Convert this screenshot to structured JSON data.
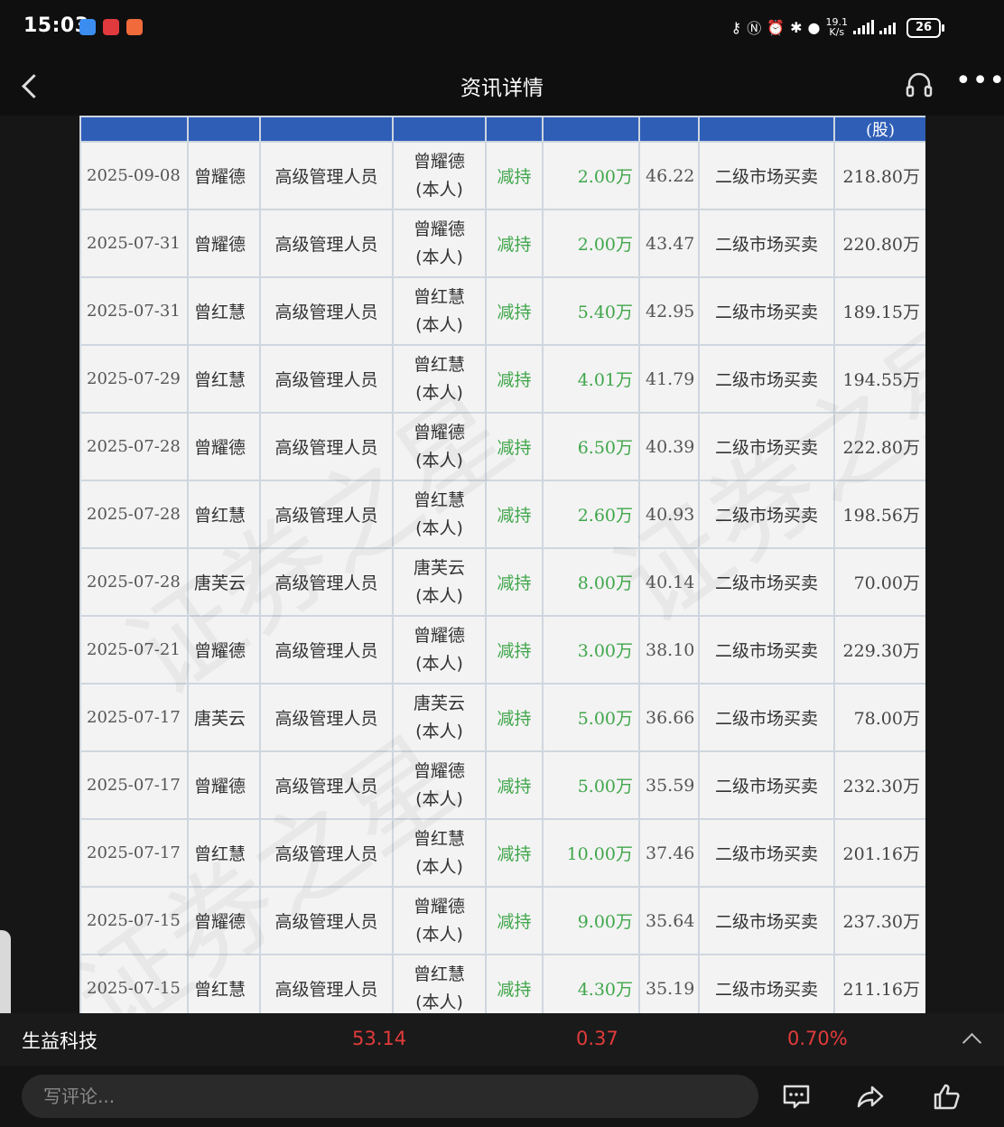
{
  "status_bar": {
    "time": "15:03",
    "speed_value": "19.1",
    "speed_unit": "K/s",
    "battery": "26"
  },
  "header": {
    "title": "资讯详情"
  },
  "table": {
    "header_visible_text": [
      "",
      "",
      "",
      "",
      "",
      "",
      "",
      "",
      "(股)"
    ],
    "rows": [
      {
        "date": "2025-09-08",
        "name": "曾耀德",
        "role": "高级管理人员",
        "rel_name": "曾耀德",
        "rel_note": "(本人)",
        "direction": "减持",
        "change": "2.00万",
        "price": "46.22",
        "method": "二级市场买卖",
        "holding": "218.80万"
      },
      {
        "date": "2025-07-31",
        "name": "曾耀德",
        "role": "高级管理人员",
        "rel_name": "曾耀德",
        "rel_note": "(本人)",
        "direction": "减持",
        "change": "2.00万",
        "price": "43.47",
        "method": "二级市场买卖",
        "holding": "220.80万"
      },
      {
        "date": "2025-07-31",
        "name": "曾红慧",
        "role": "高级管理人员",
        "rel_name": "曾红慧",
        "rel_note": "(本人)",
        "direction": "减持",
        "change": "5.40万",
        "price": "42.95",
        "method": "二级市场买卖",
        "holding": "189.15万"
      },
      {
        "date": "2025-07-29",
        "name": "曾红慧",
        "role": "高级管理人员",
        "rel_name": "曾红慧",
        "rel_note": "(本人)",
        "direction": "减持",
        "change": "4.01万",
        "price": "41.79",
        "method": "二级市场买卖",
        "holding": "194.55万"
      },
      {
        "date": "2025-07-28",
        "name": "曾耀德",
        "role": "高级管理人员",
        "rel_name": "曾耀德",
        "rel_note": "(本人)",
        "direction": "减持",
        "change": "6.50万",
        "price": "40.39",
        "method": "二级市场买卖",
        "holding": "222.80万"
      },
      {
        "date": "2025-07-28",
        "name": "曾红慧",
        "role": "高级管理人员",
        "rel_name": "曾红慧",
        "rel_note": "(本人)",
        "direction": "减持",
        "change": "2.60万",
        "price": "40.93",
        "method": "二级市场买卖",
        "holding": "198.56万"
      },
      {
        "date": "2025-07-28",
        "name": "唐芙云",
        "role": "高级管理人员",
        "rel_name": "唐芙云",
        "rel_note": "(本人)",
        "direction": "减持",
        "change": "8.00万",
        "price": "40.14",
        "method": "二级市场买卖",
        "holding": "70.00万"
      },
      {
        "date": "2025-07-21",
        "name": "曾耀德",
        "role": "高级管理人员",
        "rel_name": "曾耀德",
        "rel_note": "(本人)",
        "direction": "减持",
        "change": "3.00万",
        "price": "38.10",
        "method": "二级市场买卖",
        "holding": "229.30万"
      },
      {
        "date": "2025-07-17",
        "name": "唐芙云",
        "role": "高级管理人员",
        "rel_name": "唐芙云",
        "rel_note": "(本人)",
        "direction": "减持",
        "change": "5.00万",
        "price": "36.66",
        "method": "二级市场买卖",
        "holding": "78.00万"
      },
      {
        "date": "2025-07-17",
        "name": "曾耀德",
        "role": "高级管理人员",
        "rel_name": "曾耀德",
        "rel_note": "(本人)",
        "direction": "减持",
        "change": "5.00万",
        "price": "35.59",
        "method": "二级市场买卖",
        "holding": "232.30万"
      },
      {
        "date": "2025-07-17",
        "name": "曾红慧",
        "role": "高级管理人员",
        "rel_name": "曾红慧",
        "rel_note": "(本人)",
        "direction": "减持",
        "change": "10.00万",
        "price": "37.46",
        "method": "二级市场买卖",
        "holding": "201.16万"
      },
      {
        "date": "2025-07-15",
        "name": "曾耀德",
        "role": "高级管理人员",
        "rel_name": "曾耀德",
        "rel_note": "(本人)",
        "direction": "减持",
        "change": "9.00万",
        "price": "35.64",
        "method": "二级市场买卖",
        "holding": "237.30万"
      },
      {
        "date": "2025-07-15",
        "name": "曾红慧",
        "role": "高级管理人员",
        "rel_name": "曾红慧",
        "rel_note": "(本人)",
        "direction": "减持",
        "change": "4.30万",
        "price": "35.19",
        "method": "二级市场买卖",
        "holding": "211.16万"
      }
    ]
  },
  "watermark": "证券之星",
  "quote": {
    "stock_name": "生益科技",
    "price": "53.14",
    "change": "0.37",
    "change_pct": "0.70%"
  },
  "bottom": {
    "comment_placeholder": "写评论..."
  },
  "colors": {
    "header_blue": "#2f5eb7",
    "down_green": "#3fa64a",
    "up_red": "#e23b3b"
  }
}
